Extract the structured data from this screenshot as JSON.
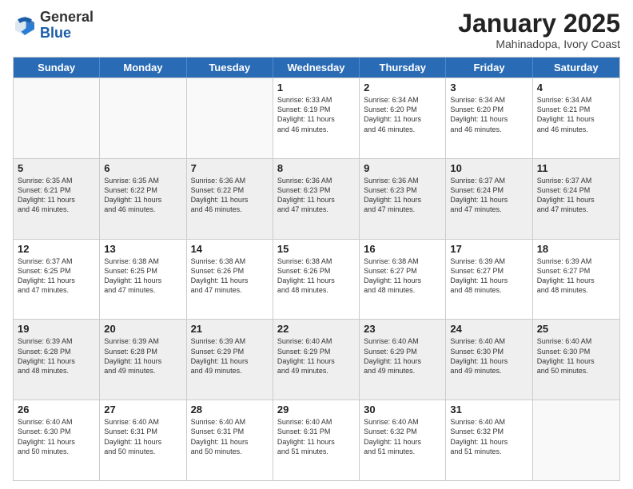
{
  "header": {
    "logo_general": "General",
    "logo_blue": "Blue",
    "month": "January 2025",
    "location": "Mahinadopa, Ivory Coast"
  },
  "weekdays": [
    "Sunday",
    "Monday",
    "Tuesday",
    "Wednesday",
    "Thursday",
    "Friday",
    "Saturday"
  ],
  "rows": [
    [
      {
        "day": "",
        "info": ""
      },
      {
        "day": "",
        "info": ""
      },
      {
        "day": "",
        "info": ""
      },
      {
        "day": "1",
        "info": "Sunrise: 6:33 AM\nSunset: 6:19 PM\nDaylight: 11 hours\nand 46 minutes."
      },
      {
        "day": "2",
        "info": "Sunrise: 6:34 AM\nSunset: 6:20 PM\nDaylight: 11 hours\nand 46 minutes."
      },
      {
        "day": "3",
        "info": "Sunrise: 6:34 AM\nSunset: 6:20 PM\nDaylight: 11 hours\nand 46 minutes."
      },
      {
        "day": "4",
        "info": "Sunrise: 6:34 AM\nSunset: 6:21 PM\nDaylight: 11 hours\nand 46 minutes."
      }
    ],
    [
      {
        "day": "5",
        "info": "Sunrise: 6:35 AM\nSunset: 6:21 PM\nDaylight: 11 hours\nand 46 minutes."
      },
      {
        "day": "6",
        "info": "Sunrise: 6:35 AM\nSunset: 6:22 PM\nDaylight: 11 hours\nand 46 minutes."
      },
      {
        "day": "7",
        "info": "Sunrise: 6:36 AM\nSunset: 6:22 PM\nDaylight: 11 hours\nand 46 minutes."
      },
      {
        "day": "8",
        "info": "Sunrise: 6:36 AM\nSunset: 6:23 PM\nDaylight: 11 hours\nand 47 minutes."
      },
      {
        "day": "9",
        "info": "Sunrise: 6:36 AM\nSunset: 6:23 PM\nDaylight: 11 hours\nand 47 minutes."
      },
      {
        "day": "10",
        "info": "Sunrise: 6:37 AM\nSunset: 6:24 PM\nDaylight: 11 hours\nand 47 minutes."
      },
      {
        "day": "11",
        "info": "Sunrise: 6:37 AM\nSunset: 6:24 PM\nDaylight: 11 hours\nand 47 minutes."
      }
    ],
    [
      {
        "day": "12",
        "info": "Sunrise: 6:37 AM\nSunset: 6:25 PM\nDaylight: 11 hours\nand 47 minutes."
      },
      {
        "day": "13",
        "info": "Sunrise: 6:38 AM\nSunset: 6:25 PM\nDaylight: 11 hours\nand 47 minutes."
      },
      {
        "day": "14",
        "info": "Sunrise: 6:38 AM\nSunset: 6:26 PM\nDaylight: 11 hours\nand 47 minutes."
      },
      {
        "day": "15",
        "info": "Sunrise: 6:38 AM\nSunset: 6:26 PM\nDaylight: 11 hours\nand 48 minutes."
      },
      {
        "day": "16",
        "info": "Sunrise: 6:38 AM\nSunset: 6:27 PM\nDaylight: 11 hours\nand 48 minutes."
      },
      {
        "day": "17",
        "info": "Sunrise: 6:39 AM\nSunset: 6:27 PM\nDaylight: 11 hours\nand 48 minutes."
      },
      {
        "day": "18",
        "info": "Sunrise: 6:39 AM\nSunset: 6:27 PM\nDaylight: 11 hours\nand 48 minutes."
      }
    ],
    [
      {
        "day": "19",
        "info": "Sunrise: 6:39 AM\nSunset: 6:28 PM\nDaylight: 11 hours\nand 48 minutes."
      },
      {
        "day": "20",
        "info": "Sunrise: 6:39 AM\nSunset: 6:28 PM\nDaylight: 11 hours\nand 49 minutes."
      },
      {
        "day": "21",
        "info": "Sunrise: 6:39 AM\nSunset: 6:29 PM\nDaylight: 11 hours\nand 49 minutes."
      },
      {
        "day": "22",
        "info": "Sunrise: 6:40 AM\nSunset: 6:29 PM\nDaylight: 11 hours\nand 49 minutes."
      },
      {
        "day": "23",
        "info": "Sunrise: 6:40 AM\nSunset: 6:29 PM\nDaylight: 11 hours\nand 49 minutes."
      },
      {
        "day": "24",
        "info": "Sunrise: 6:40 AM\nSunset: 6:30 PM\nDaylight: 11 hours\nand 49 minutes."
      },
      {
        "day": "25",
        "info": "Sunrise: 6:40 AM\nSunset: 6:30 PM\nDaylight: 11 hours\nand 50 minutes."
      }
    ],
    [
      {
        "day": "26",
        "info": "Sunrise: 6:40 AM\nSunset: 6:30 PM\nDaylight: 11 hours\nand 50 minutes."
      },
      {
        "day": "27",
        "info": "Sunrise: 6:40 AM\nSunset: 6:31 PM\nDaylight: 11 hours\nand 50 minutes."
      },
      {
        "day": "28",
        "info": "Sunrise: 6:40 AM\nSunset: 6:31 PM\nDaylight: 11 hours\nand 50 minutes."
      },
      {
        "day": "29",
        "info": "Sunrise: 6:40 AM\nSunset: 6:31 PM\nDaylight: 11 hours\nand 51 minutes."
      },
      {
        "day": "30",
        "info": "Sunrise: 6:40 AM\nSunset: 6:32 PM\nDaylight: 11 hours\nand 51 minutes."
      },
      {
        "day": "31",
        "info": "Sunrise: 6:40 AM\nSunset: 6:32 PM\nDaylight: 11 hours\nand 51 minutes."
      },
      {
        "day": "",
        "info": ""
      }
    ]
  ]
}
